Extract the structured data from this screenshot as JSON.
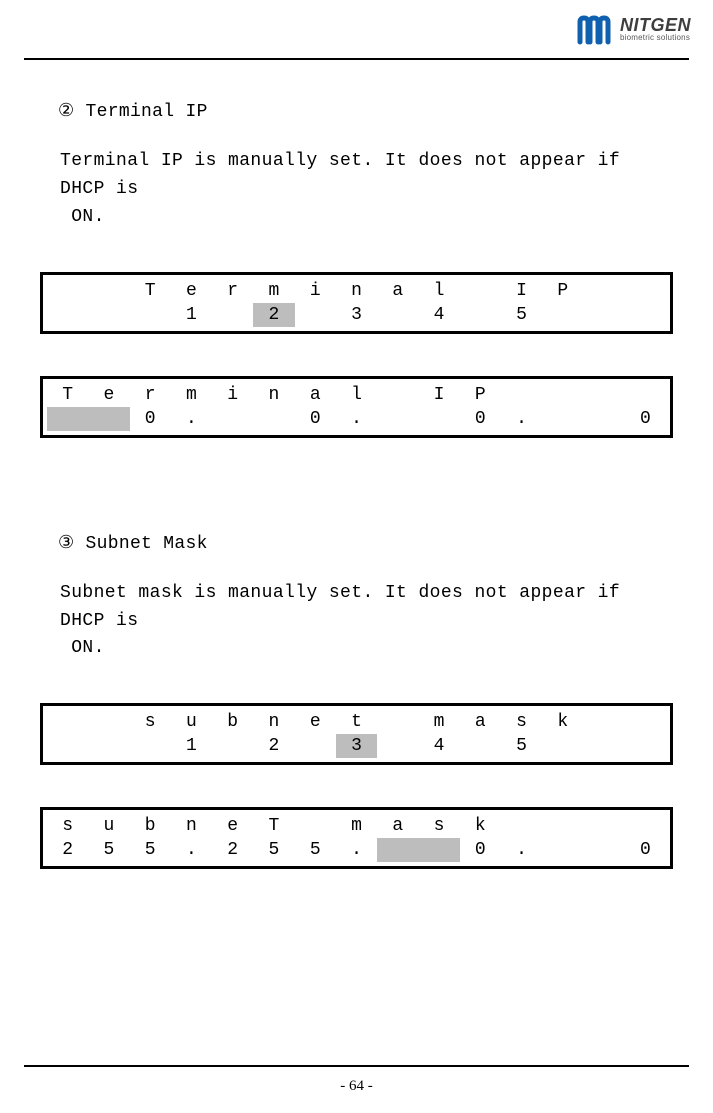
{
  "logo": {
    "brand": "NITGEN",
    "tagline": "biometric solutions"
  },
  "page_number": "- 64 -",
  "sections": [
    {
      "bullet": "②",
      "title": "Terminal IP",
      "desc_line1": "Terminal IP is manually set. It does not appear if DHCP is",
      "desc_line2": "ON.",
      "lcd_menu": {
        "label_cells": [
          "",
          "",
          "T",
          "e",
          "r",
          "m",
          "i",
          "n",
          "a",
          "l",
          "",
          "I",
          "P",
          "",
          ""
        ],
        "value_cells": [
          "",
          "",
          "",
          "1",
          "",
          "2",
          "",
          "3",
          "",
          "4",
          "",
          "5",
          "",
          "",
          ""
        ],
        "value_highlight_idx": [
          5
        ]
      },
      "lcd_entry": {
        "label_cells": [
          "T",
          "e",
          "r",
          "m",
          "i",
          "n",
          "a",
          "l",
          "",
          "I",
          "P",
          "",
          "",
          "",
          ""
        ],
        "value_cells": [
          "",
          "",
          "0",
          ".",
          "",
          "",
          "0",
          ".",
          "",
          "",
          "0",
          ".",
          "",
          "",
          "0"
        ],
        "value_highlight_idx": [
          0,
          1
        ],
        "right_align_last": true
      }
    },
    {
      "bullet": "③",
      "title": "Subnet Mask",
      "desc_line1": "Subnet mask is manually set. It does not appear if DHCP is",
      "desc_line2": "ON.",
      "lcd_menu": {
        "label_cells": [
          "",
          "",
          "s",
          "u",
          "b",
          "n",
          "e",
          "t",
          "",
          "m",
          "a",
          "s",
          "k",
          "",
          ""
        ],
        "value_cells": [
          "",
          "",
          "",
          "1",
          "",
          "2",
          "",
          "3",
          "",
          "4",
          "",
          "5",
          "",
          "",
          ""
        ],
        "value_highlight_idx": [
          7
        ]
      },
      "lcd_entry": {
        "label_cells": [
          "s",
          "u",
          "b",
          "n",
          "e",
          "T",
          "",
          "m",
          "a",
          "s",
          "k",
          "",
          "",
          "",
          ""
        ],
        "value_cells": [
          "2",
          "5",
          "5",
          ".",
          "2",
          "5",
          "5",
          ".",
          "",
          "",
          "0",
          ".",
          "",
          "",
          "0"
        ],
        "value_highlight_idx": [
          8,
          9
        ],
        "right_align_last": true
      }
    }
  ]
}
